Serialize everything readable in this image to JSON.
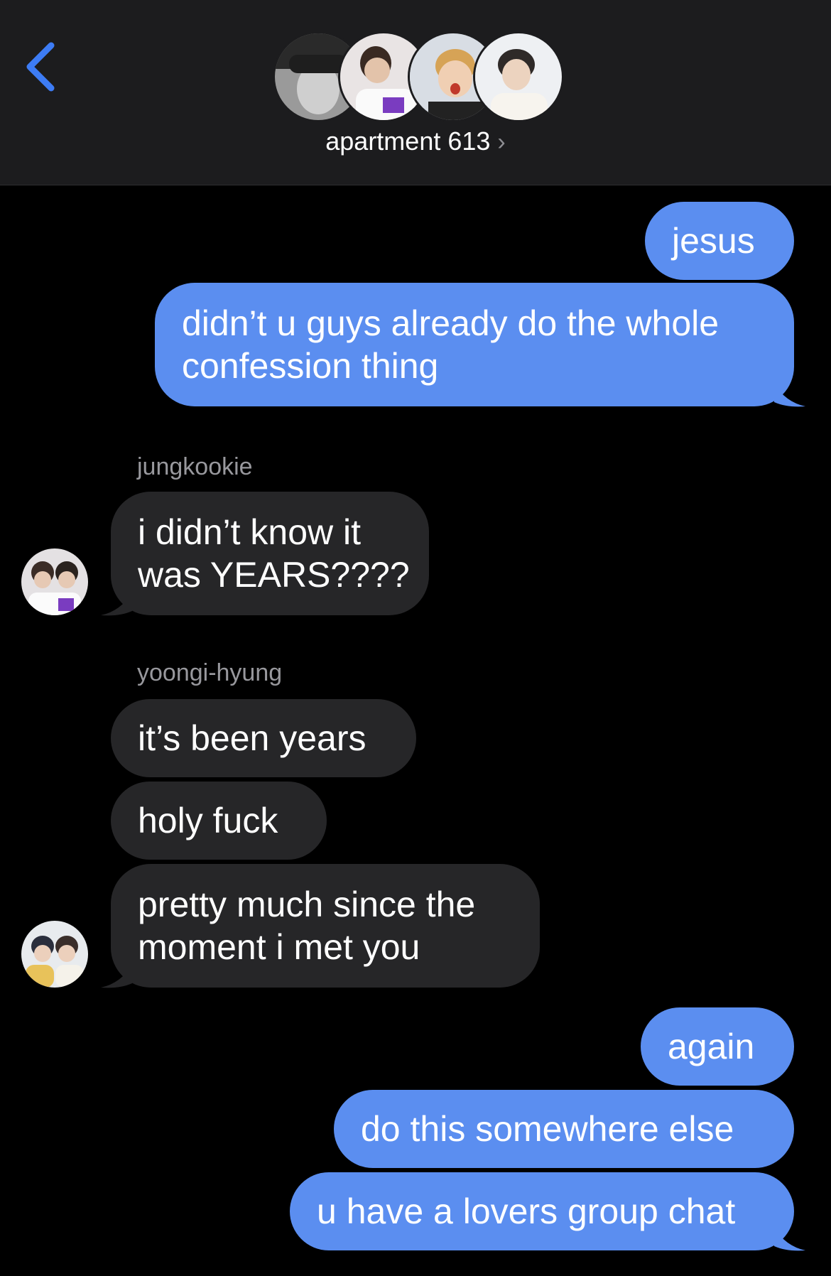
{
  "header": {
    "title": "apartment 613",
    "chevron": "›",
    "back_icon": "chevron-left-icon",
    "accent": "#3d7cf5"
  },
  "messages": [
    {
      "side": "out",
      "text": "jesus"
    },
    {
      "side": "out",
      "lines": [
        "didn’t u guys already do the whole",
        "confession thing"
      ]
    },
    {
      "side": "in",
      "sender": "jungkookie",
      "lines": [
        "i didn’t know it",
        "was YEARS????"
      ]
    },
    {
      "side": "in",
      "sender": "yoongi-hyung",
      "text": "it’s been years"
    },
    {
      "side": "in",
      "text": "holy fuck"
    },
    {
      "side": "in",
      "lines": [
        "pretty much since the",
        "moment i met you"
      ]
    },
    {
      "side": "out",
      "text": "again"
    },
    {
      "side": "out",
      "text": "do this somewhere else"
    },
    {
      "side": "out",
      "text": "u have a lovers group chat"
    }
  ],
  "colors": {
    "outgoing_bubble": "#5b8ef0",
    "incoming_bubble": "#262628",
    "background": "#000000",
    "header_bg": "#1c1c1e"
  }
}
